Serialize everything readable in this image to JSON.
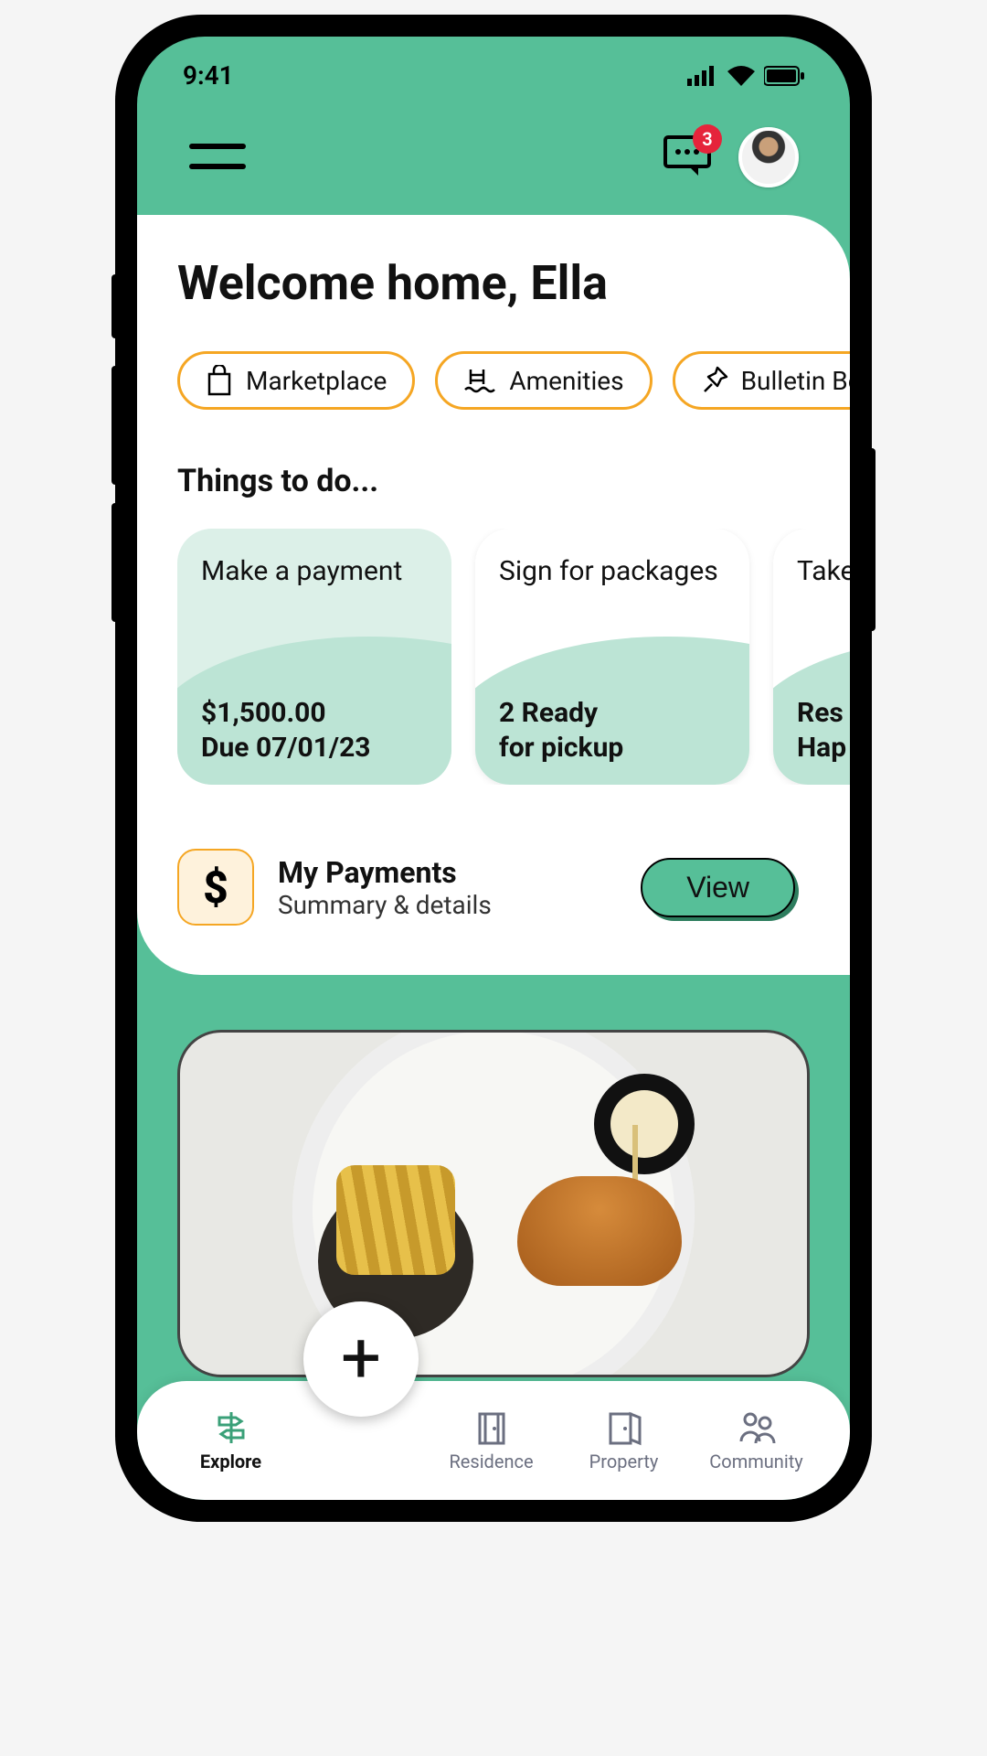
{
  "status": {
    "time": "9:41"
  },
  "header": {
    "msg_badge": "3"
  },
  "welcome": "Welcome home, Ella",
  "chips": [
    {
      "label": "Marketplace",
      "icon": "bag"
    },
    {
      "label": "Amenities",
      "icon": "pool"
    },
    {
      "label": "Bulletin Bo",
      "icon": "pin"
    }
  ],
  "things": {
    "title": "Things to do...",
    "cards": [
      {
        "title": "Make a payment",
        "line1": "$1,500.00",
        "line2": "Due 07/01/23"
      },
      {
        "title": "Sign for packages",
        "line1": "2 Ready",
        "line2": "for pickup"
      },
      {
        "title": "Take surv",
        "line1": "Res",
        "line2": "Hap"
      }
    ]
  },
  "payments": {
    "title": "My Payments",
    "subtitle": "Summary & details",
    "button": "View",
    "icon": "$"
  },
  "tabs": [
    {
      "label": "Explore"
    },
    {
      "label": "Residence"
    },
    {
      "label": "Property"
    },
    {
      "label": "Community"
    }
  ]
}
